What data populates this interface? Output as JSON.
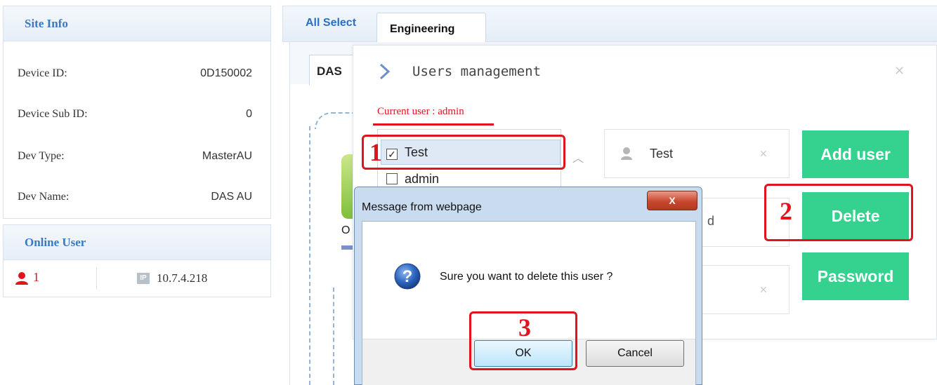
{
  "site_info": {
    "title": "Site Info",
    "rows": [
      {
        "label": "Device ID:",
        "value": "0D150002"
      },
      {
        "label": "Device Sub ID:",
        "value": "0"
      },
      {
        "label": "Dev Type:",
        "value": "MasterAU"
      },
      {
        "label": "Dev Name:",
        "value": "DAS AU"
      }
    ]
  },
  "online_user": {
    "title": "Online User",
    "count": "1",
    "ip_badge": "IP",
    "ip": "10.7.4.218"
  },
  "tabs": {
    "all_select": "All Select",
    "engineering": "Engineering",
    "sub_tab": "DAS",
    "partial_text": "O"
  },
  "users_management": {
    "title": "Users management",
    "current_user": "Current user : admin",
    "list": [
      {
        "name": "Test",
        "checked": true
      },
      {
        "name": "admin",
        "checked": false
      }
    ],
    "username_value": "Test",
    "field2_partial": "d",
    "buttons": {
      "add": "Add user",
      "delete": "Delete",
      "password": "Password"
    }
  },
  "dialog": {
    "title": "Message from webpage",
    "close": "X",
    "message": "Sure you want to delete this user ?",
    "ok": "OK",
    "cancel": "Cancel"
  },
  "annotations": {
    "step1": "1",
    "step2": "2",
    "step3": "3"
  },
  "colors": {
    "accent_green": "#35d28f",
    "annotation_red": "#e0141f",
    "header_blue": "#3a78c2"
  }
}
